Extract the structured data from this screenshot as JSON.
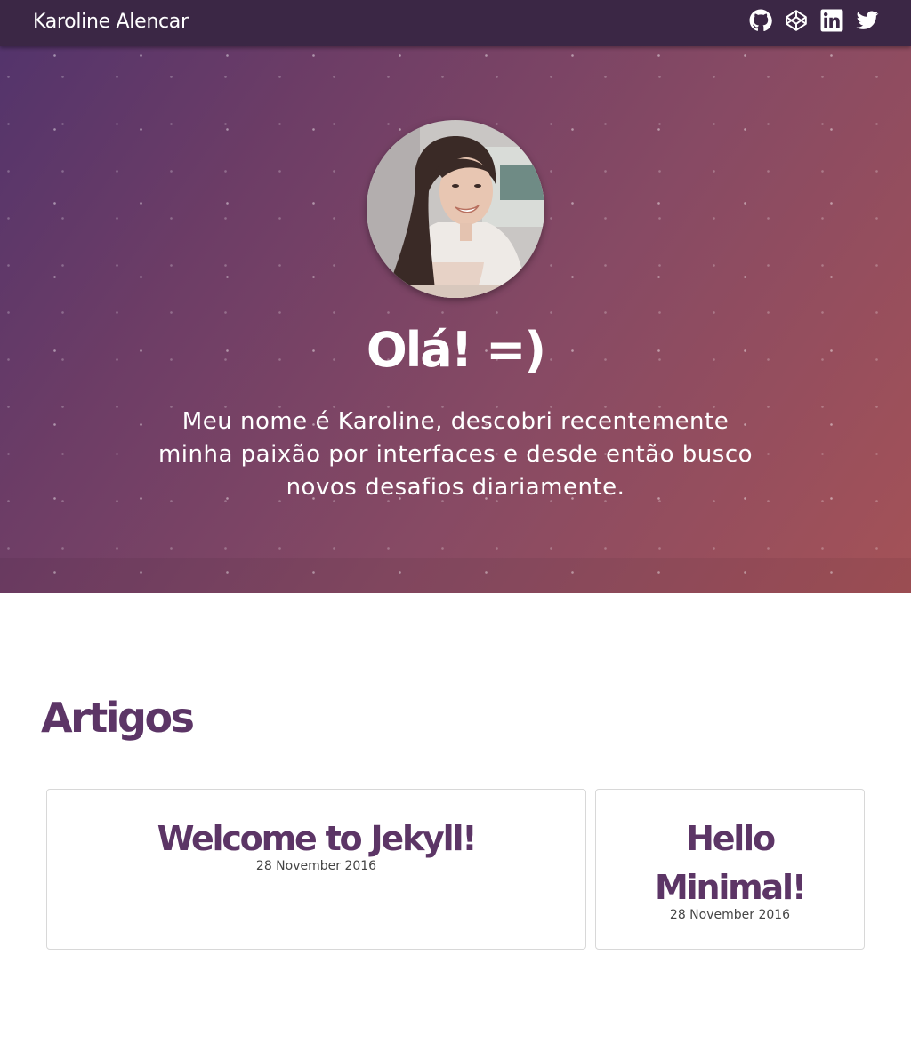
{
  "header": {
    "brand": "Karoline Alencar",
    "social": [
      "github-icon",
      "codepen-icon",
      "linkedin-icon",
      "twitter-icon"
    ]
  },
  "hero": {
    "title": "Olá! =)",
    "text": "Meu nome é Karoline, descobri recentemente minha paixão por interfaces e desde então busco novos desafios diariamente."
  },
  "articles": {
    "title": "Artigos",
    "posts": [
      {
        "title": "Welcome to Jekyll!",
        "date": "28 November 2016"
      },
      {
        "title": "Hello Minimal!",
        "date": "28 November 2016"
      }
    ]
  },
  "colors": {
    "accent": "#5c3566",
    "topbar": "#3b2745",
    "hero_start": "#51336c",
    "hero_end": "#a45257"
  }
}
